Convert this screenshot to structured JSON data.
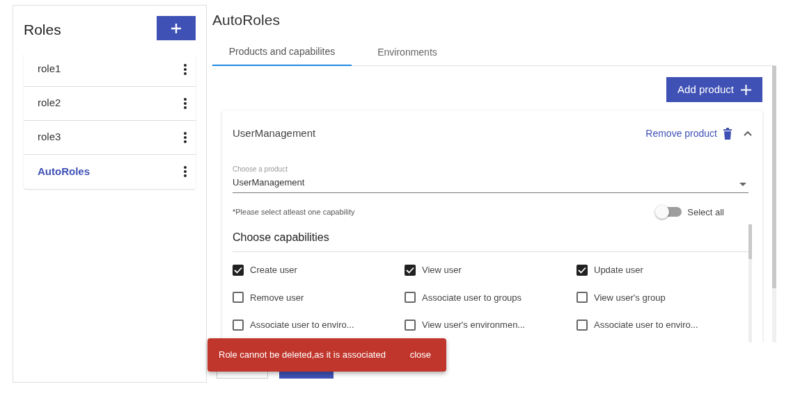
{
  "sidebar": {
    "title": "Roles",
    "items": [
      {
        "label": "role1",
        "selected": false
      },
      {
        "label": "role2",
        "selected": false
      },
      {
        "label": "role3",
        "selected": false
      },
      {
        "label": "AutoRoles",
        "selected": true
      }
    ]
  },
  "main": {
    "title": "AutoRoles",
    "tabs": [
      {
        "label": "Products and capabilites",
        "selected": true
      },
      {
        "label": "Environments",
        "selected": false
      }
    ],
    "add_button": "Add product",
    "product": {
      "name": "UserManagement",
      "remove_label": "Remove product",
      "expanded": true,
      "select": {
        "label": "Choose a product",
        "value": "UserManagement"
      },
      "hint": "*Please select atleast one capability",
      "select_all": {
        "label": "Select all",
        "on": false
      },
      "capabilities_title": "Choose capabilities",
      "capabilities": [
        {
          "label": "Create user",
          "checked": true
        },
        {
          "label": "View user",
          "checked": true
        },
        {
          "label": "Update user",
          "checked": true
        },
        {
          "label": "Remove user",
          "checked": false
        },
        {
          "label": "Associate user to groups",
          "checked": false
        },
        {
          "label": "View user's group",
          "checked": false
        },
        {
          "label": "Associate user to enviro...",
          "checked": false
        },
        {
          "label": "View user's environmen...",
          "checked": false
        },
        {
          "label": "Associate user to enviro...",
          "checked": false
        }
      ]
    }
  },
  "snackbar": {
    "message": "Role cannot be deleted,as it is associated",
    "action": "close"
  }
}
